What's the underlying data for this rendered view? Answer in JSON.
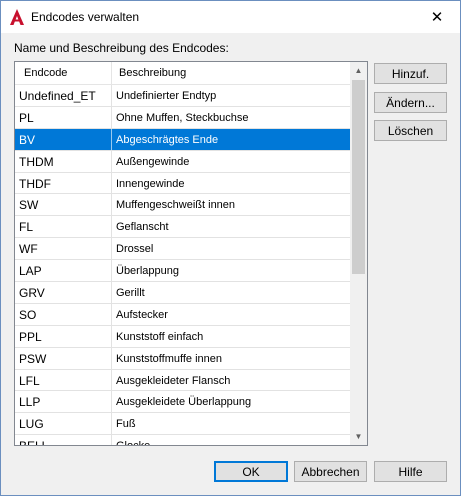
{
  "window": {
    "title": "Endcodes verwalten"
  },
  "list_label": "Name und Beschreibung des Endcodes:",
  "columns": [
    "Endcode",
    "Beschreibung"
  ],
  "rows": [
    {
      "code": "Undefined_ET",
      "desc": "Undefinierter Endtyp"
    },
    {
      "code": "PL",
      "desc": "Ohne Muffen, Steckbuchse"
    },
    {
      "code": "BV",
      "desc": "Abgeschrägtes Ende"
    },
    {
      "code": "THDM",
      "desc": "Außengewinde"
    },
    {
      "code": "THDF",
      "desc": "Innengewinde"
    },
    {
      "code": "SW",
      "desc": "Muffengeschweißt innen"
    },
    {
      "code": "FL",
      "desc": "Geflanscht"
    },
    {
      "code": "WF",
      "desc": "Drossel"
    },
    {
      "code": "LAP",
      "desc": "Überlappung"
    },
    {
      "code": "GRV",
      "desc": "Gerillt"
    },
    {
      "code": "SO",
      "desc": "Aufstecker"
    },
    {
      "code": "PPL",
      "desc": "Kunststoff einfach"
    },
    {
      "code": "PSW",
      "desc": "Kunststoffmuffe innen"
    },
    {
      "code": "LFL",
      "desc": "Ausgekleideter Flansch"
    },
    {
      "code": "LLP",
      "desc": "Ausgekleidete Überlappung"
    },
    {
      "code": "LUG",
      "desc": "Fuß"
    },
    {
      "code": "BELL",
      "desc": "Glocke"
    }
  ],
  "selected_index": 2,
  "side_buttons": {
    "add": "Hinzuf.",
    "edit": "Ändern...",
    "delete": "Löschen"
  },
  "bottom_buttons": {
    "ok": "OK",
    "cancel": "Abbrechen",
    "help": "Hilfe"
  },
  "colors": {
    "selection": "#0078d7",
    "app_icon": "#c8102e"
  }
}
